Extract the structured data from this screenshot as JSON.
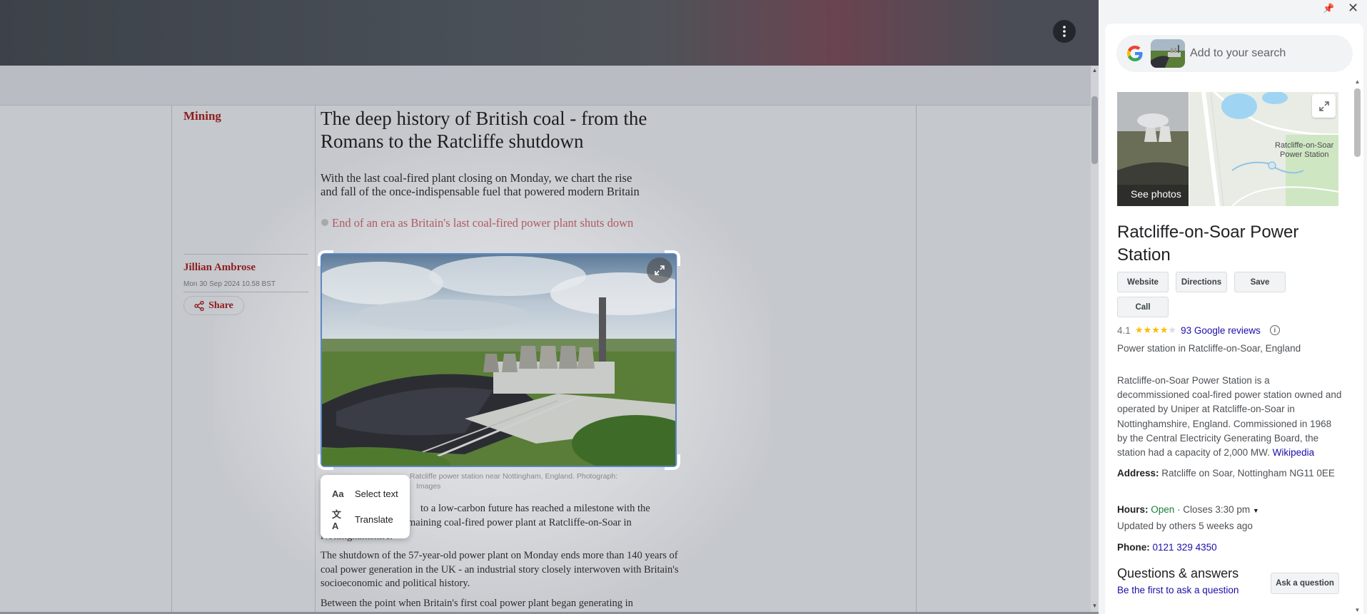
{
  "article": {
    "section": "Mining",
    "headline": "The deep history of British coal - from the Romans to the Ratcliffe shutdown",
    "standfirst": "With the last coal-fired plant closing on Monday, we chart the rise and fall of the once-indispensable fuel that powered modern Britain",
    "related_link": "End of an era as Britain's last coal-fired power plant shuts down",
    "author": "Jillian Ambrose",
    "date": "Mon 30 Sep 2024 10.58 BST",
    "share_label": "Share",
    "caption_line1": "Ratcliffe power station near Nottingham, England. Photograph:",
    "caption_line2": "Images",
    "body_p1_l1": "to a low-carbon future has reached a milestone with the",
    "body_p1_l2": "maining coal-fired power plant at Ratcliffe-on-Soar in",
    "body_p1_l3": "Nottinghamshire.",
    "body_p2": "The shutdown of the 57-year-old power plant on Monday ends more than 140 years of coal power generation in the UK - an industrial story closely interwoven with Britain's socioeconomic and political history.",
    "body_p3": "Between the point when Britain's first coal power plant began generating in"
  },
  "lens_popup": {
    "select_text_label": "Select text",
    "translate_label": "Translate"
  },
  "panel": {
    "search_placeholder": "Add to your search",
    "see_photos_label": "See photos",
    "map_label_line1": "Ratcliffe-on-Soar",
    "map_label_line2": "Power Station",
    "title": "Ratcliffe-on-Soar Power Station",
    "actions": {
      "website": "Website",
      "directions": "Directions",
      "save": "Save",
      "call": "Call"
    },
    "rating": "4.1",
    "rating_stars": 4.1,
    "reviews_label": "93 Google reviews",
    "category": "Power station in Ratcliffe-on-Soar, England",
    "description": "Ratcliffe-on-Soar Power Station is a decommissioned coal-fired power station owned and operated by Uniper at Ratcliffe-on-Soar in Nottinghamshire, England. Commissioned in 1968 by the Central Electricity Generating Board, the station had a capacity of 2,000 MW.",
    "description_source": "Wikipedia",
    "address_label": "Address:",
    "address_value": "Ratcliffe on Soar, Nottingham NG11 0EE",
    "hours_label": "Hours:",
    "hours_status": "Open",
    "hours_closes": "· Closes 3:30 pm",
    "hours_updated": "Updated by others 5 weeks ago",
    "phone_label": "Phone:",
    "phone_value": "0121 329 4350",
    "qa_title": "Questions & answers",
    "qa_link": "Be the first to ask a question",
    "ask_button": "Ask a question"
  },
  "colors": {
    "accent_red": "#8f1d1d",
    "link_blue": "#1a0dab",
    "open_green": "#188038",
    "star_yellow": "#fbbc04"
  },
  "icons": [
    "more-vert-icon",
    "share-icon",
    "expand-icon",
    "select-text-icon",
    "translate-icon",
    "pin-icon",
    "close-icon",
    "google-logo",
    "info-icon",
    "chevron-down-icon"
  ]
}
